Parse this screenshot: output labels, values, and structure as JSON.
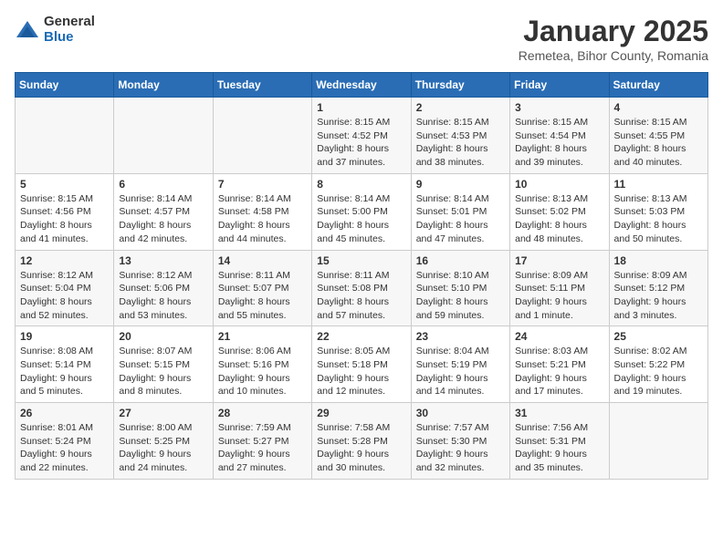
{
  "logo": {
    "general": "General",
    "blue": "Blue"
  },
  "title": "January 2025",
  "subtitle": "Remetea, Bihor County, Romania",
  "weekdays": [
    "Sunday",
    "Monday",
    "Tuesday",
    "Wednesday",
    "Thursday",
    "Friday",
    "Saturday"
  ],
  "weeks": [
    [
      {
        "day": "",
        "info": ""
      },
      {
        "day": "",
        "info": ""
      },
      {
        "day": "",
        "info": ""
      },
      {
        "day": "1",
        "info": "Sunrise: 8:15 AM\nSunset: 4:52 PM\nDaylight: 8 hours and 37 minutes."
      },
      {
        "day": "2",
        "info": "Sunrise: 8:15 AM\nSunset: 4:53 PM\nDaylight: 8 hours and 38 minutes."
      },
      {
        "day": "3",
        "info": "Sunrise: 8:15 AM\nSunset: 4:54 PM\nDaylight: 8 hours and 39 minutes."
      },
      {
        "day": "4",
        "info": "Sunrise: 8:15 AM\nSunset: 4:55 PM\nDaylight: 8 hours and 40 minutes."
      }
    ],
    [
      {
        "day": "5",
        "info": "Sunrise: 8:15 AM\nSunset: 4:56 PM\nDaylight: 8 hours and 41 minutes."
      },
      {
        "day": "6",
        "info": "Sunrise: 8:14 AM\nSunset: 4:57 PM\nDaylight: 8 hours and 42 minutes."
      },
      {
        "day": "7",
        "info": "Sunrise: 8:14 AM\nSunset: 4:58 PM\nDaylight: 8 hours and 44 minutes."
      },
      {
        "day": "8",
        "info": "Sunrise: 8:14 AM\nSunset: 5:00 PM\nDaylight: 8 hours and 45 minutes."
      },
      {
        "day": "9",
        "info": "Sunrise: 8:14 AM\nSunset: 5:01 PM\nDaylight: 8 hours and 47 minutes."
      },
      {
        "day": "10",
        "info": "Sunrise: 8:13 AM\nSunset: 5:02 PM\nDaylight: 8 hours and 48 minutes."
      },
      {
        "day": "11",
        "info": "Sunrise: 8:13 AM\nSunset: 5:03 PM\nDaylight: 8 hours and 50 minutes."
      }
    ],
    [
      {
        "day": "12",
        "info": "Sunrise: 8:12 AM\nSunset: 5:04 PM\nDaylight: 8 hours and 52 minutes."
      },
      {
        "day": "13",
        "info": "Sunrise: 8:12 AM\nSunset: 5:06 PM\nDaylight: 8 hours and 53 minutes."
      },
      {
        "day": "14",
        "info": "Sunrise: 8:11 AM\nSunset: 5:07 PM\nDaylight: 8 hours and 55 minutes."
      },
      {
        "day": "15",
        "info": "Sunrise: 8:11 AM\nSunset: 5:08 PM\nDaylight: 8 hours and 57 minutes."
      },
      {
        "day": "16",
        "info": "Sunrise: 8:10 AM\nSunset: 5:10 PM\nDaylight: 8 hours and 59 minutes."
      },
      {
        "day": "17",
        "info": "Sunrise: 8:09 AM\nSunset: 5:11 PM\nDaylight: 9 hours and 1 minute."
      },
      {
        "day": "18",
        "info": "Sunrise: 8:09 AM\nSunset: 5:12 PM\nDaylight: 9 hours and 3 minutes."
      }
    ],
    [
      {
        "day": "19",
        "info": "Sunrise: 8:08 AM\nSunset: 5:14 PM\nDaylight: 9 hours and 5 minutes."
      },
      {
        "day": "20",
        "info": "Sunrise: 8:07 AM\nSunset: 5:15 PM\nDaylight: 9 hours and 8 minutes."
      },
      {
        "day": "21",
        "info": "Sunrise: 8:06 AM\nSunset: 5:16 PM\nDaylight: 9 hours and 10 minutes."
      },
      {
        "day": "22",
        "info": "Sunrise: 8:05 AM\nSunset: 5:18 PM\nDaylight: 9 hours and 12 minutes."
      },
      {
        "day": "23",
        "info": "Sunrise: 8:04 AM\nSunset: 5:19 PM\nDaylight: 9 hours and 14 minutes."
      },
      {
        "day": "24",
        "info": "Sunrise: 8:03 AM\nSunset: 5:21 PM\nDaylight: 9 hours and 17 minutes."
      },
      {
        "day": "25",
        "info": "Sunrise: 8:02 AM\nSunset: 5:22 PM\nDaylight: 9 hours and 19 minutes."
      }
    ],
    [
      {
        "day": "26",
        "info": "Sunrise: 8:01 AM\nSunset: 5:24 PM\nDaylight: 9 hours and 22 minutes."
      },
      {
        "day": "27",
        "info": "Sunrise: 8:00 AM\nSunset: 5:25 PM\nDaylight: 9 hours and 24 minutes."
      },
      {
        "day": "28",
        "info": "Sunrise: 7:59 AM\nSunset: 5:27 PM\nDaylight: 9 hours and 27 minutes."
      },
      {
        "day": "29",
        "info": "Sunrise: 7:58 AM\nSunset: 5:28 PM\nDaylight: 9 hours and 30 minutes."
      },
      {
        "day": "30",
        "info": "Sunrise: 7:57 AM\nSunset: 5:30 PM\nDaylight: 9 hours and 32 minutes."
      },
      {
        "day": "31",
        "info": "Sunrise: 7:56 AM\nSunset: 5:31 PM\nDaylight: 9 hours and 35 minutes."
      },
      {
        "day": "",
        "info": ""
      }
    ]
  ]
}
